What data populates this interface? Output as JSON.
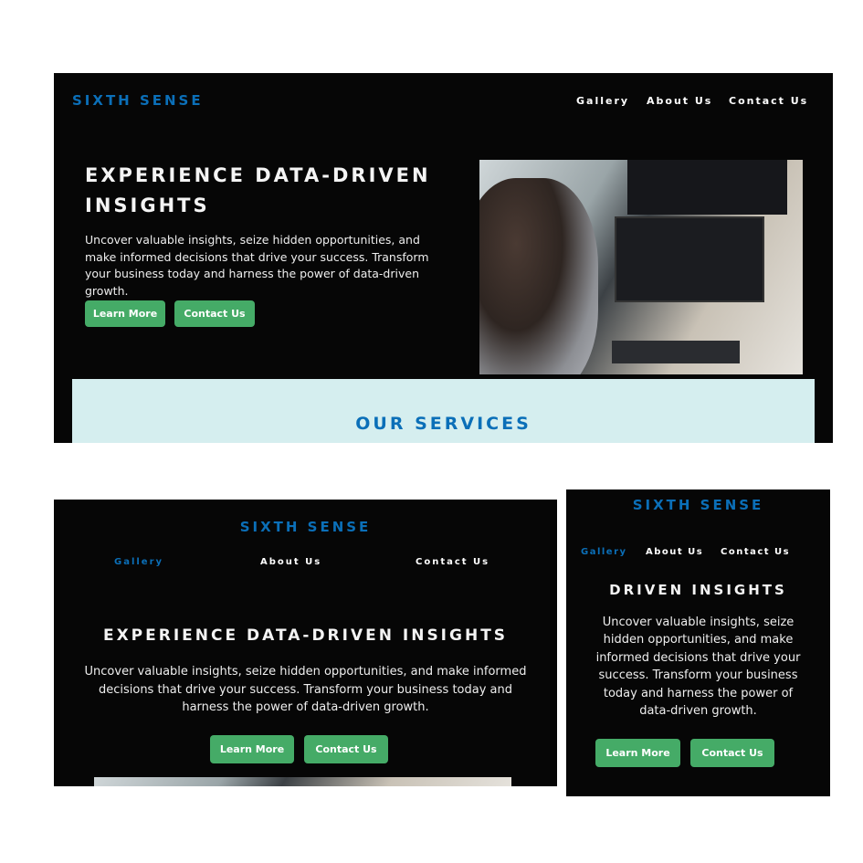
{
  "brand": "SIXTH SENSE",
  "nav": [
    "Gallery",
    "About Us",
    "Contact Us"
  ],
  "hero": {
    "title": "EXPERIENCE DATA-DRIVEN INSIGHTS",
    "title_mobile": "DRIVEN INSIGHTS",
    "text": "Uncover valuable insights, seize hidden opportunities, and make informed decisions that drive your success. Transform your business today and harness the power of data-driven growth.",
    "learn_more": "Learn More",
    "contact": "Contact Us"
  },
  "services": {
    "title": "OUR SERVICES"
  },
  "colors": {
    "brand": "#0b6fb8",
    "button": "#45ab67",
    "background": "#060606",
    "services_bg": "#d5eeef"
  }
}
